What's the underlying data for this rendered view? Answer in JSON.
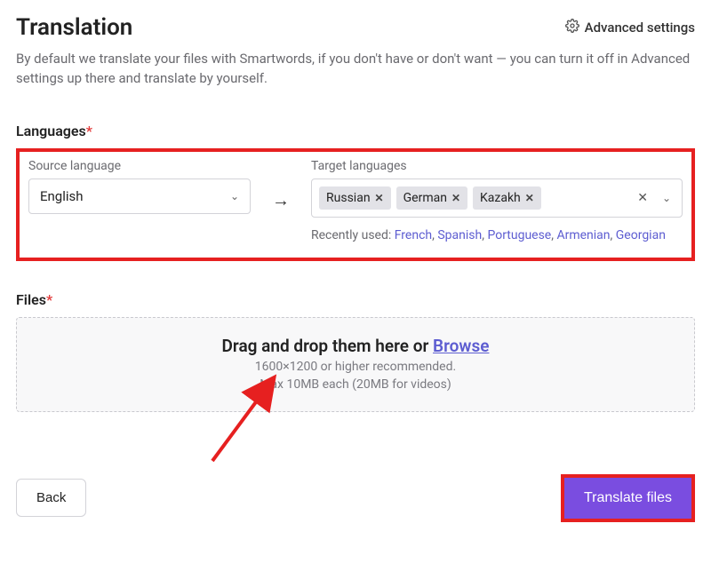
{
  "header": {
    "title": "Translation",
    "advanced_settings": "Advanced settings"
  },
  "description": "By default we translate your files with Smartwords, if you don't have or don't want — you can turn it off in Advanced settings up there and translate by yourself.",
  "languages": {
    "section_label": "Languages",
    "source_label": "Source language",
    "source_value": "English",
    "arrow": "→",
    "target_label": "Target languages",
    "chips": [
      "Russian",
      "German",
      "Kazakh"
    ],
    "recent_label": "Recently used: ",
    "recent": [
      "French",
      "Spanish",
      "Portuguese",
      "Armenian",
      "Georgian"
    ]
  },
  "files": {
    "section_label": "Files",
    "drop_main_1": "Drag and drop them here or ",
    "drop_main_link": "Browse",
    "drop_line2": "1600×1200 or higher recommended.",
    "drop_line3": "Max 10MB each (20MB for videos)"
  },
  "footer": {
    "back": "Back",
    "translate": "Translate files"
  },
  "colors": {
    "highlight_border": "#e62020",
    "primary_button": "#7a4de0",
    "link": "#5d5dd1"
  }
}
